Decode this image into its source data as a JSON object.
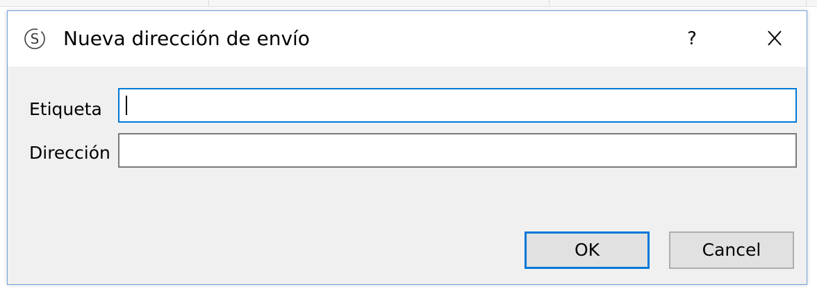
{
  "dialog": {
    "title": "Nueva dirección de envío",
    "app_icon": "s-circle-icon",
    "help_label": "?",
    "close_icon": "close-icon"
  },
  "form": {
    "label_field": {
      "label": "Etiqueta",
      "value": "",
      "focused": true
    },
    "address_field": {
      "label": "Dirección",
      "value": ""
    }
  },
  "buttons": {
    "ok_label": "OK",
    "cancel_label": "Cancel"
  },
  "colors": {
    "accent": "#0078d7",
    "window_bg": "#f0f0f0",
    "titlebar_bg": "#ffffff",
    "button_bg": "#e1e1e1"
  }
}
